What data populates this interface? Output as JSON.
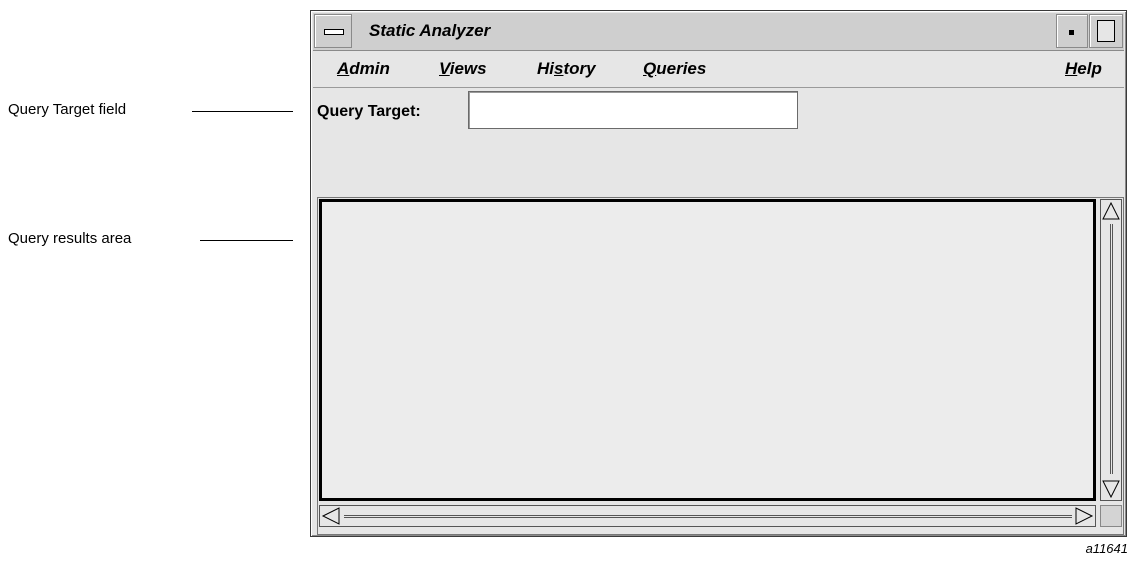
{
  "callouts": {
    "query_target": "Query Target field",
    "query_results": "Query results area"
  },
  "window": {
    "title": "Static Analyzer"
  },
  "menubar": {
    "items": [
      {
        "label": "Admin",
        "mnemonic": "A",
        "rest": "dmin"
      },
      {
        "label": "Views",
        "mnemonic": "V",
        "rest": "iews"
      },
      {
        "label": "History",
        "pre": "Hi",
        "mnemonic": "s",
        "rest": "tory"
      },
      {
        "label": "Queries",
        "mnemonic": "Q",
        "rest": "ueries"
      },
      {
        "label": "Help",
        "mnemonic": "H",
        "rest": "elp"
      }
    ]
  },
  "query": {
    "label": "Query Target:",
    "value": ""
  },
  "figure_id": "a11641"
}
